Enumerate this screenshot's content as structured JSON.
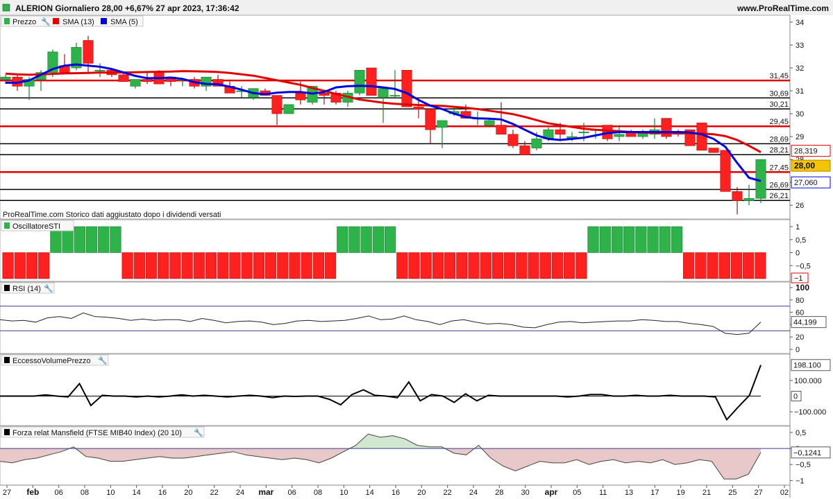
{
  "header": {
    "title": "ALERION Giornaliero 28,00 +6,67% 27 apr 2023, 17:36:42",
    "site": "www.ProRealTime.com"
  },
  "price_panel": {
    "legend": [
      "Prezzo",
      "SMA (13)",
      "SMA (5)"
    ],
    "footnote": "ProRealTime.com  Storico dati aggiustato dopo i dividendi versati",
    "axis_ticks": [
      "34",
      "33",
      "32",
      "31",
      "30",
      "29",
      "28",
      "27",
      "26"
    ],
    "levels": [
      {
        "value": 31.45,
        "label": "31,45",
        "color": "#e00000"
      },
      {
        "value": 30.69,
        "label": "30,69",
        "color": "#000000"
      },
      {
        "value": 30.21,
        "label": "30,21",
        "color": "#000000"
      },
      {
        "value": 29.45,
        "label": "29,45",
        "color": "#e00000"
      },
      {
        "value": 28.69,
        "label": "28,69",
        "color": "#000000"
      },
      {
        "value": 28.21,
        "label": "28,21",
        "color": "#000000"
      },
      {
        "value": 27.45,
        "label": "27,45",
        "color": "#e00000"
      },
      {
        "value": 26.69,
        "label": "26,69",
        "color": "#000000"
      },
      {
        "value": 26.21,
        "label": "26,21",
        "color": "#000000"
      }
    ],
    "badges": {
      "sma13": "28,319",
      "price": "28,00",
      "sma5": "27,060"
    }
  },
  "sti_panel": {
    "legend": "OscillatoreSTI",
    "axis_ticks": [
      "1",
      "0,5",
      "0",
      "−0,5"
    ],
    "badge": "−1"
  },
  "rsi_panel": {
    "legend": "RSI (14)",
    "axis_ticks": [
      "100",
      "80",
      "60",
      "40",
      "20",
      "0"
    ],
    "badge": "44,199"
  },
  "volume_panel": {
    "legend": "EccessoVolumePrezzo",
    "axis_ticks": [
      "100.000",
      "−100.000"
    ],
    "badge_top": "198.100",
    "badge_zero": "0"
  },
  "mansfield_panel": {
    "legend": "Forza relat Mansfield (FTSE MIB40 Index) (20 10)",
    "axis_ticks": [
      "0,5",
      "0",
      "−0,5",
      "−1"
    ],
    "badge": "−0,1241"
  },
  "x_axis": {
    "labels": [
      "27",
      "feb",
      "06",
      "08",
      "10",
      "14",
      "16",
      "20",
      "22",
      "24",
      "mar",
      "06",
      "08",
      "10",
      "14",
      "16",
      "20",
      "22",
      "24",
      "28",
      "30",
      "apr",
      "05",
      "11",
      "13",
      "17",
      "19",
      "21",
      "25",
      "27",
      "02"
    ],
    "bold": [
      "feb",
      "mar",
      "apr"
    ]
  },
  "colors": {
    "up": "#2db34a",
    "down": "#ff2020",
    "sma13": "#e00000",
    "sma5": "#0000dd"
  },
  "chart_data": [
    {
      "type": "candlestick",
      "title": "ALERION Giornaliero",
      "ylim": [
        25.4,
        34.3
      ],
      "series": [
        {
          "name": "Prezzo",
          "ohlc": [
            [
              31.5,
              31.7,
              31.3,
              31.6
            ],
            [
              31.6,
              31.7,
              31.0,
              31.2
            ],
            [
              31.2,
              31.6,
              30.6,
              31.5
            ],
            [
              31.5,
              31.9,
              31.0,
              31.8
            ],
            [
              31.8,
              32.8,
              31.6,
              32.7
            ],
            [
              32.1,
              32.6,
              31.8,
              31.8
            ],
            [
              32.0,
              33.1,
              31.9,
              32.9
            ],
            [
              33.2,
              33.4,
              31.8,
              32.2
            ],
            [
              31.9,
              32.2,
              31.6,
              31.9
            ],
            [
              31.9,
              31.9,
              31.6,
              31.7
            ],
            [
              31.7,
              31.8,
              31.4,
              31.4
            ],
            [
              31.2,
              31.5,
              31.1,
              31.5
            ],
            [
              31.5,
              31.8,
              31.3,
              31.4
            ],
            [
              31.8,
              31.9,
              31.3,
              31.3
            ],
            [
              31.6,
              31.6,
              31.2,
              31.4
            ],
            [
              31.5,
              31.5,
              31.2,
              31.5
            ],
            [
              31.5,
              31.6,
              31.1,
              31.2
            ],
            [
              31.2,
              31.6,
              31.0,
              31.6
            ],
            [
              31.5,
              31.7,
              31.2,
              31.2
            ],
            [
              31.2,
              31.4,
              30.9,
              30.9
            ],
            [
              31.0,
              31.2,
              30.7,
              31.0
            ],
            [
              30.7,
              31.1,
              30.6,
              31.1
            ],
            [
              31.0,
              31.1,
              30.8,
              30.8
            ],
            [
              30.8,
              30.8,
              29.5,
              30.0
            ],
            [
              30.0,
              30.4,
              30.0,
              30.4
            ],
            [
              30.9,
              31.4,
              30.4,
              30.6
            ],
            [
              30.5,
              31.2,
              30.4,
              31.2
            ],
            [
              30.9,
              31.0,
              30.4,
              30.8
            ],
            [
              30.9,
              31.0,
              30.4,
              30.5
            ],
            [
              30.5,
              31.0,
              30.3,
              30.9
            ],
            [
              30.9,
              31.9,
              30.8,
              31.9
            ],
            [
              32.0,
              32.0,
              30.8,
              30.8
            ],
            [
              30.7,
              31.1,
              29.6,
              31.1
            ],
            [
              30.8,
              31.9,
              30.7,
              30.8
            ],
            [
              31.9,
              31.9,
              30.3,
              30.3
            ],
            [
              30.3,
              30.7,
              29.8,
              30.2
            ],
            [
              30.2,
              30.2,
              28.7,
              29.3
            ],
            [
              29.4,
              29.7,
              28.5,
              29.7
            ],
            [
              30.0,
              30.3,
              29.9,
              30.1
            ],
            [
              30.1,
              30.4,
              29.8,
              29.8
            ],
            [
              29.8,
              30.1,
              29.5,
              29.8
            ],
            [
              29.5,
              29.8,
              29.4,
              29.7
            ],
            [
              29.5,
              30.5,
              29.4,
              29.1
            ],
            [
              29.1,
              29.3,
              28.5,
              28.6
            ],
            [
              28.6,
              28.8,
              28.2,
              28.2
            ],
            [
              28.5,
              29.2,
              28.4,
              28.9
            ],
            [
              28.9,
              29.4,
              28.8,
              29.3
            ],
            [
              29.3,
              29.6,
              28.8,
              29.1
            ],
            [
              28.9,
              29.2,
              28.8,
              29.0
            ],
            [
              29.2,
              29.6,
              28.8,
              29.2
            ],
            [
              29.3,
              29.3,
              28.9,
              29.3
            ],
            [
              29.5,
              29.5,
              28.8,
              28.9
            ],
            [
              29.0,
              29.5,
              28.8,
              29.1
            ],
            [
              29.2,
              29.3,
              29.0,
              29.0
            ],
            [
              29.0,
              29.3,
              28.9,
              29.2
            ],
            [
              29.1,
              29.8,
              28.9,
              29.3
            ],
            [
              29.8,
              29.8,
              28.9,
              29.0
            ],
            [
              29.2,
              29.3,
              29.0,
              29.1
            ],
            [
              29.3,
              29.3,
              28.6,
              28.6
            ],
            [
              29.6,
              29.6,
              28.4,
              28.4
            ],
            [
              28.5,
              28.5,
              28.3,
              28.3
            ],
            [
              28.4,
              28.4,
              26.6,
              26.6
            ],
            [
              26.6,
              26.8,
              25.6,
              26.2
            ],
            [
              26.2,
              26.9,
              26.0,
              26.3
            ],
            [
              26.3,
              28.0,
              26.1,
              28.0
            ]
          ]
        },
        {
          "name": "SMA (13)",
          "values": [
            31.75,
            31.72,
            31.7,
            31.72,
            31.74,
            31.76,
            31.77,
            31.78,
            31.8,
            31.79,
            31.8,
            31.81,
            31.82,
            31.83,
            31.84,
            31.86,
            31.85,
            31.84,
            31.82,
            31.78,
            31.72,
            31.66,
            31.56,
            31.46,
            31.36,
            31.26,
            31.12,
            31.0,
            30.86,
            30.74,
            30.62,
            30.55,
            30.48,
            30.43,
            30.4,
            30.38,
            30.36,
            30.34,
            30.3,
            30.26,
            30.2,
            30.13,
            30.06,
            29.98,
            29.86,
            29.72,
            29.58,
            29.5,
            29.42,
            29.34,
            29.3,
            29.27,
            29.24,
            29.2,
            29.17,
            29.16,
            29.15,
            29.15,
            29.14,
            29.13,
            29.1,
            29.02,
            28.85,
            28.6,
            28.319
          ]
        },
        {
          "name": "SMA (5)",
          "values": [
            31.35,
            31.35,
            31.45,
            31.7,
            31.95,
            32.1,
            32.15,
            32.1,
            32.05,
            31.95,
            31.8,
            31.65,
            31.55,
            31.55,
            31.58,
            31.52,
            31.38,
            31.3,
            31.28,
            31.18,
            31.05,
            30.9,
            30.85,
            30.92,
            30.95,
            30.95,
            30.88,
            30.95,
            31.15,
            31.2,
            31.22,
            31.2,
            31.15,
            31.08,
            30.9,
            30.6,
            30.35,
            30.2,
            30.0,
            29.85,
            29.8,
            29.78,
            29.75,
            29.55,
            29.3,
            29.05,
            28.9,
            28.85,
            28.9,
            28.95,
            29.05,
            29.15,
            29.2,
            29.2,
            29.2,
            29.2,
            29.2,
            29.2,
            29.18,
            29.1,
            28.9,
            28.55,
            27.85,
            27.2,
            27.06
          ]
        }
      ]
    },
    {
      "type": "bar",
      "title": "OscillatoreSTI",
      "ylim": [
        -1,
        1
      ],
      "values": [
        -1,
        -1,
        -1,
        -1,
        1,
        1,
        1,
        1,
        1,
        1,
        -1,
        -1,
        -1,
        -1,
        -1,
        -1,
        -1,
        -1,
        -1,
        -1,
        -1,
        -1,
        -1,
        -1,
        -1,
        -1,
        -1,
        -1,
        1,
        1,
        1,
        1,
        1,
        -1,
        -1,
        -1,
        -1,
        -1,
        -1,
        -1,
        -1,
        -1,
        -1,
        -1,
        -1,
        -1,
        -1,
        -1,
        -1,
        1,
        1,
        1,
        1,
        1,
        1,
        1,
        1,
        -1,
        -1,
        -1,
        -1,
        -1,
        -1,
        -1
      ]
    },
    {
      "type": "line",
      "title": "RSI (14)",
      "ylim": [
        0,
        100
      ],
      "values": [
        48,
        46,
        47,
        44,
        51,
        53,
        50,
        59,
        53,
        52,
        50,
        47,
        49,
        47,
        48,
        48,
        45,
        50,
        47,
        43,
        45,
        46,
        44,
        40,
        42,
        46,
        47,
        45,
        46,
        47,
        50,
        54,
        48,
        49,
        54,
        48,
        45,
        40,
        46,
        48,
        44,
        41,
        42,
        40,
        36,
        35,
        40,
        44,
        45,
        43,
        44,
        45,
        46,
        46,
        48,
        47,
        45,
        45,
        42,
        40,
        37,
        26,
        24,
        26,
        44.199
      ]
    },
    {
      "type": "line",
      "title": "EccessoVolumePrezzo",
      "ylim": [
        -170000,
        250000
      ],
      "values": [
        0,
        0,
        0,
        0,
        8000,
        0,
        -5000,
        80000,
        -60000,
        5000,
        0,
        0,
        -5000,
        0,
        -5000,
        0,
        8000,
        0,
        5000,
        0,
        -5000,
        0,
        5000,
        0,
        -10000,
        0,
        -2000,
        0,
        0,
        -20000,
        -55000,
        10000,
        40000,
        5000,
        0,
        -10000,
        90000,
        -30000,
        10000,
        0,
        -40000,
        15000,
        -30000,
        5000,
        0,
        0,
        0,
        0,
        0,
        0,
        -5000,
        0,
        10000,
        10000,
        0,
        0,
        5000,
        0,
        0,
        5000,
        0,
        0,
        0,
        -5000,
        -150000,
        -70000,
        5000,
        198100
      ]
    },
    {
      "type": "area",
      "title": "Forza relat Mansfield (FTSE MIB40 Index) (20 10)",
      "ylim": [
        -1.1,
        0.65
      ],
      "values": [
        -0.4,
        -0.45,
        -0.35,
        -0.3,
        -0.2,
        -0.1,
        0.05,
        -0.25,
        -0.3,
        -0.4,
        -0.4,
        -0.35,
        -0.3,
        -0.25,
        -0.3,
        -0.3,
        -0.25,
        -0.2,
        -0.15,
        -0.1,
        -0.2,
        -0.25,
        -0.3,
        -0.35,
        -0.3,
        -0.35,
        -0.45,
        -0.3,
        -0.1,
        0.1,
        0.45,
        0.35,
        0.4,
        0.3,
        0.1,
        0.05,
        0.05,
        -0.15,
        -0.2,
        0.1,
        -0.3,
        -0.55,
        -0.7,
        -0.55,
        -0.4,
        -0.45,
        -0.45,
        -0.35,
        -0.5,
        -0.4,
        -0.35,
        -0.45,
        -0.4,
        -0.45,
        -0.35,
        -0.5,
        -0.45,
        -0.35,
        -0.4,
        -0.95,
        -0.95,
        -0.8,
        -0.1241
      ]
    }
  ]
}
